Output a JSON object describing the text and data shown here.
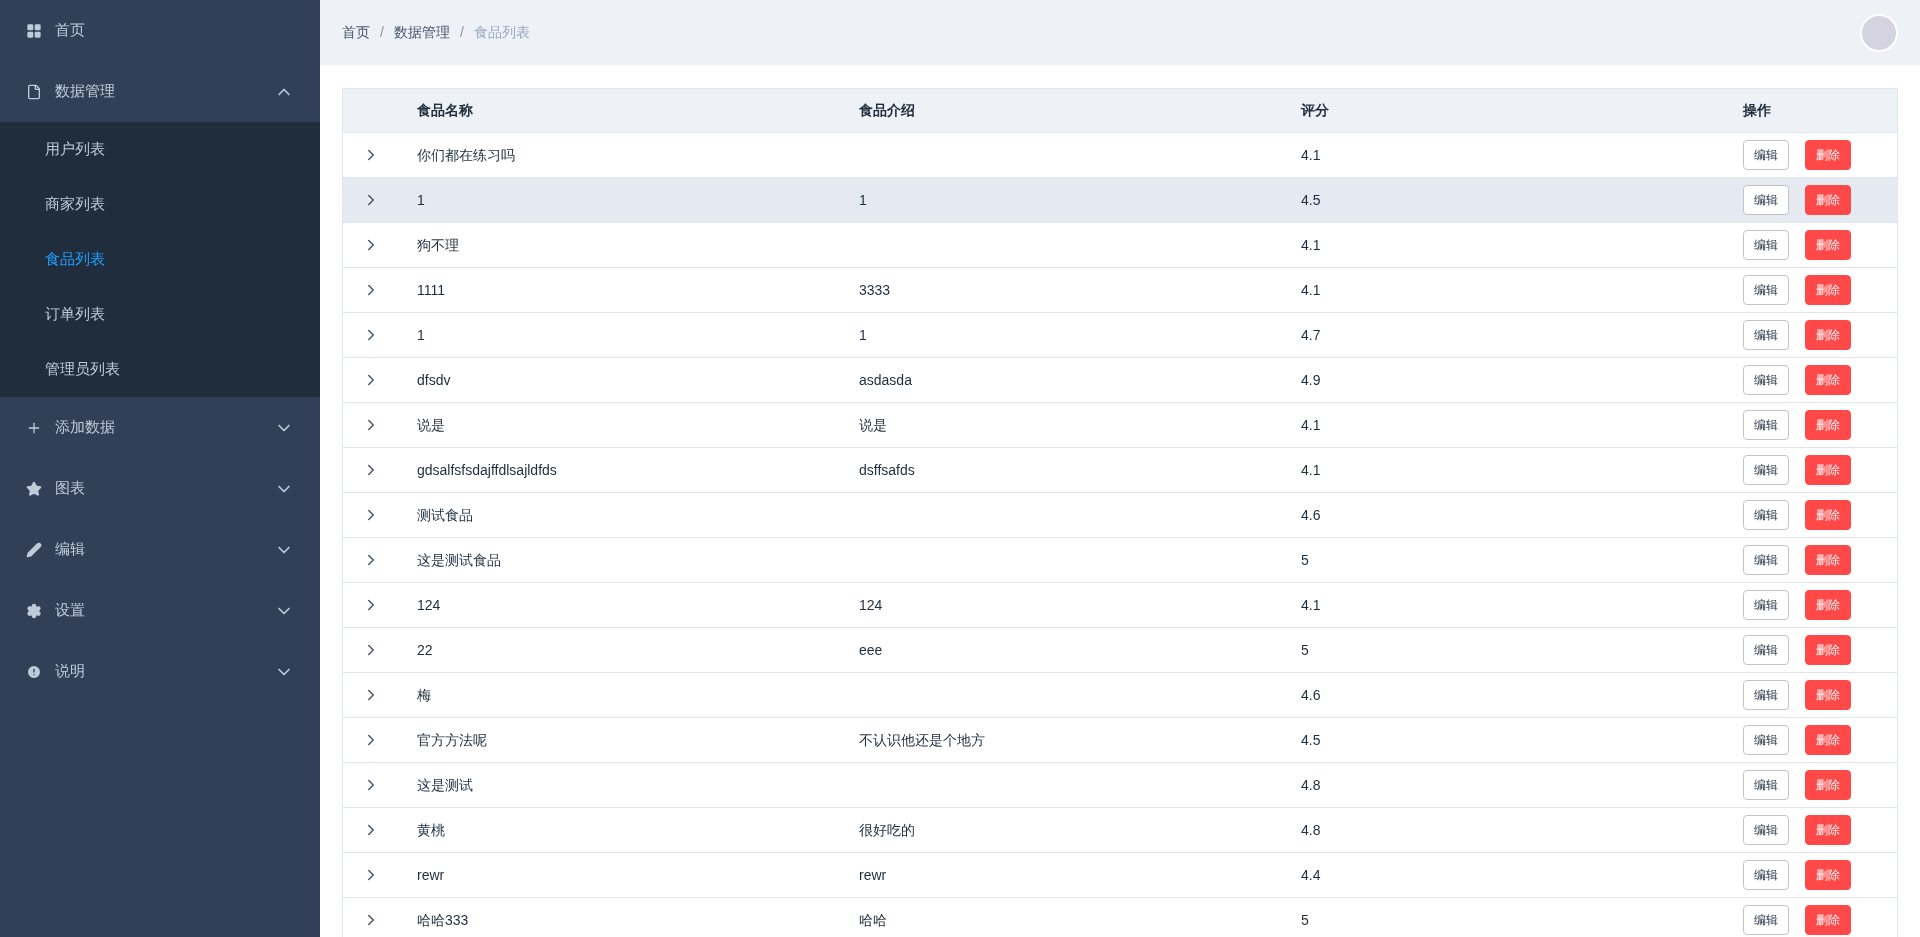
{
  "sidebar": {
    "items": [
      {
        "label": "首页"
      },
      {
        "label": "数据管理",
        "expanded": true,
        "children": [
          {
            "label": "用户列表",
            "selected": false
          },
          {
            "label": "商家列表",
            "selected": false
          },
          {
            "label": "食品列表",
            "selected": true
          },
          {
            "label": "订单列表",
            "selected": false
          },
          {
            "label": "管理员列表",
            "selected": false
          }
        ]
      },
      {
        "label": "添加数据",
        "expanded": false
      },
      {
        "label": "图表",
        "expanded": false
      },
      {
        "label": "编辑",
        "expanded": false
      },
      {
        "label": "设置",
        "expanded": false
      },
      {
        "label": "说明",
        "expanded": false
      }
    ]
  },
  "breadcrumb": [
    {
      "label": "首页"
    },
    {
      "separator": "/",
      "label": "数据管理"
    },
    {
      "separator": "/",
      "label": "食品列表"
    }
  ],
  "table": {
    "columns": [
      "食品名称",
      "食品介绍",
      "评分",
      "操作"
    ],
    "rows": [
      {
        "name": "你们都在练习吗",
        "intro": "",
        "rating": "4.1",
        "selected": false,
        "actions": [
          "编辑",
          "删除"
        ]
      },
      {
        "name": "1",
        "intro": "1",
        "rating": "4.5",
        "selected": true,
        "actions": [
          "编辑",
          "删除"
        ]
      },
      {
        "name": "狗不理",
        "intro": "",
        "rating": "4.1",
        "selected": false,
        "actions": [
          "编辑",
          "删除"
        ]
      },
      {
        "name": "1111",
        "intro": "3333",
        "rating": "4.1",
        "selected": false,
        "actions": [
          "编辑",
          "删除"
        ]
      },
      {
        "name": "1",
        "intro": "1",
        "rating": "4.7",
        "selected": false,
        "actions": [
          "编辑",
          "删除"
        ]
      },
      {
        "name": "dfsdv",
        "intro": "asdasda",
        "rating": "4.9",
        "selected": false,
        "actions": [
          "编辑",
          "删除"
        ]
      },
      {
        "name": "说是",
        "intro": "说是",
        "rating": "4.1",
        "selected": false,
        "actions": [
          "编辑",
          "删除"
        ]
      },
      {
        "name": "gdsalfsfsdajffdlsajldfds",
        "intro": "dsffsafds",
        "rating": "4.1",
        "selected": false,
        "actions": [
          "编辑",
          "删除"
        ]
      },
      {
        "name": "测试食品",
        "intro": "",
        "rating": "4.6",
        "selected": false,
        "actions": [
          "编辑",
          "删除"
        ]
      },
      {
        "name": "这是测试食品",
        "intro": "",
        "rating": "5",
        "selected": false,
        "actions": [
          "编辑",
          "删除"
        ]
      },
      {
        "name": "124",
        "intro": "124",
        "rating": "4.1",
        "selected": false,
        "actions": [
          "编辑",
          "删除"
        ]
      },
      {
        "name": "22",
        "intro": "eee",
        "rating": "5",
        "selected": false,
        "actions": [
          "编辑",
          "删除"
        ]
      },
      {
        "name": "梅",
        "intro": "",
        "rating": "4.6",
        "selected": false,
        "actions": [
          "编辑",
          "删除"
        ]
      },
      {
        "name": "官方方法呢",
        "intro": "不认识他还是个地方",
        "rating": "4.5",
        "selected": false,
        "actions": [
          "编辑",
          "删除"
        ]
      },
      {
        "name": "这是测试",
        "intro": "",
        "rating": "4.8",
        "selected": false,
        "actions": [
          "编辑",
          "删除"
        ]
      },
      {
        "name": "黄桃",
        "intro": "很好吃的",
        "rating": "4.8",
        "selected": false,
        "actions": [
          "编辑",
          "删除"
        ]
      },
      {
        "name": "rewr",
        "intro": "rewr",
        "rating": "4.4",
        "selected": false,
        "actions": [
          "编辑",
          "删除"
        ]
      },
      {
        "name": "哈哈333",
        "intro": "哈哈",
        "rating": "5",
        "selected": false,
        "actions": [
          "编辑",
          "删除"
        ]
      }
    ]
  }
}
